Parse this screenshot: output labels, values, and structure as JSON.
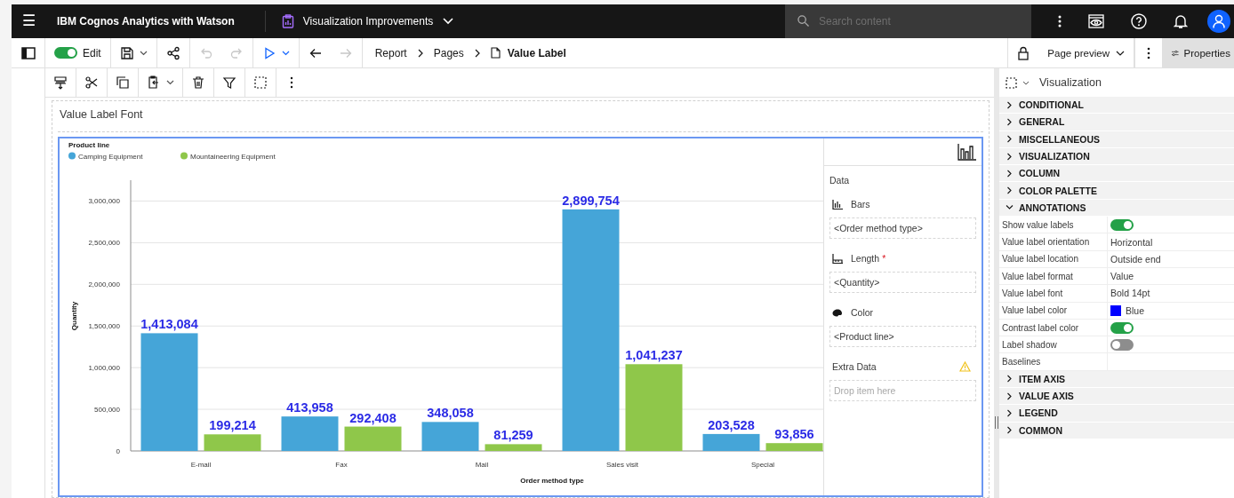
{
  "top_bar": {
    "menu": "☰",
    "product": "IBM Cognos Analytics with Watson",
    "report_name": "Visualization Improvements",
    "search": {
      "placeholder": "Search content"
    }
  },
  "toolbar": {
    "edit_mode": {
      "label": "Edit",
      "on": true
    },
    "buttons": [
      {
        "kind": "save",
        "disabled": false,
        "menu": true
      },
      {
        "kind": "share",
        "disabled": false,
        "menu": false
      },
      {
        "kind": "undo",
        "disabled": true,
        "menu": false
      },
      {
        "kind": "redo",
        "disabled": true,
        "menu": false
      },
      {
        "kind": "run",
        "disabled": false,
        "menu": true
      },
      {
        "kind": "back",
        "disabled": false,
        "menu": false
      },
      {
        "kind": "forward",
        "disabled": true,
        "menu": false
      }
    ],
    "breadcrumb": [
      "Report",
      "Pages",
      "Value Label"
    ],
    "page_preview": "Page preview",
    "properties": {
      "label": "Properties",
      "selected": true
    }
  },
  "edit_toolbar": [
    {
      "kind": "format",
      "menu": false
    },
    {
      "kind": "cut",
      "menu": false
    },
    {
      "kind": "copy",
      "menu": false
    },
    {
      "kind": "paste",
      "menu": true
    },
    {
      "kind": "delete",
      "menu": false
    },
    {
      "kind": "filter",
      "menu": false
    },
    {
      "kind": "select",
      "menu": false
    },
    {
      "kind": "more",
      "menu": false
    }
  ],
  "canvas": {
    "title": "Value Label Font",
    "chart": {
      "legend_title": "Product line",
      "chart_data": {
        "type": "bar",
        "xlabel": "Order method type",
        "ylabel": "Quantity",
        "categories": [
          "E-mail",
          "Fax",
          "Mail",
          "Sales visit",
          "Special"
        ],
        "series": [
          {
            "name": "Camping Equipment",
            "color": "#45a5d8",
            "values": [
              1413084,
              413958,
              348058,
              2899754,
              203528
            ],
            "value_labels": [
              "1,413,084",
              "413,958",
              "348,058",
              "2,899,754",
              "203,528"
            ]
          },
          {
            "name": "Mountaineering Equipment",
            "color": "#8fc74a",
            "values": [
              199214,
              292408,
              81259,
              1041237,
              93856
            ],
            "value_labels": [
              "199,214",
              "292,408",
              "81,259",
              "1,041,237",
              "93,856"
            ]
          }
        ],
        "ylim": [
          0,
          3250000
        ],
        "yticks": [
          {
            "value": 0,
            "label": "0"
          },
          {
            "value": 500000,
            "label": "500,000"
          },
          {
            "value": 1000000,
            "label": "1,000,000"
          },
          {
            "value": 1500000,
            "label": "1,500,000"
          },
          {
            "value": 2000000,
            "label": "2,000,000"
          },
          {
            "value": 2500000,
            "label": "2,500,000"
          },
          {
            "value": 3000000,
            "label": "3,000,000"
          }
        ],
        "grid": true,
        "legend": true
      }
    },
    "data_panel": {
      "title": "Data",
      "slots": [
        {
          "kind": "bars",
          "label": "Bars",
          "value": "<Order method type>"
        },
        {
          "kind": "length",
          "label": "Length",
          "required_mark": "*",
          "value": "<Quantity>"
        },
        {
          "kind": "color",
          "label": "Color",
          "value": "<Product line>"
        },
        {
          "kind": "extra",
          "label": "Extra Data",
          "warning": true,
          "placeholder": "Drop item here"
        }
      ]
    }
  },
  "properties_panel": {
    "title": "Visualization",
    "sections": [
      {
        "title": "CONDITIONAL",
        "expanded": false
      },
      {
        "title": "GENERAL",
        "expanded": false
      },
      {
        "title": "MISCELLANEOUS",
        "expanded": false
      },
      {
        "title": "VISUALIZATION",
        "expanded": false
      },
      {
        "title": "COLUMN",
        "expanded": false
      },
      {
        "title": "COLOR PALETTE",
        "expanded": false
      },
      {
        "title": "ANNOTATIONS",
        "expanded": true,
        "rows": [
          {
            "label": "Show value labels",
            "kind": "toggle",
            "on": true
          },
          {
            "label": "Value label orientation",
            "kind": "text",
            "value": "Horizontal"
          },
          {
            "label": "Value label location",
            "kind": "text",
            "value": "Outside end"
          },
          {
            "label": "Value label format",
            "kind": "text",
            "value": "Value"
          },
          {
            "label": "Value label font",
            "kind": "text",
            "value": "Bold 14pt"
          },
          {
            "label": "Value label color",
            "kind": "color",
            "value": "Blue",
            "color": "#0000ff"
          },
          {
            "label": "Contrast label color",
            "kind": "toggle",
            "on": true
          },
          {
            "label": "Label shadow",
            "kind": "toggle",
            "on": false
          },
          {
            "label": "Baselines",
            "kind": "text"
          }
        ]
      },
      {
        "title": "ITEM AXIS",
        "expanded": false
      },
      {
        "title": "VALUE AXIS",
        "expanded": false
      },
      {
        "title": "LEGEND",
        "expanded": false
      },
      {
        "title": "COMMON",
        "expanded": false
      }
    ]
  }
}
